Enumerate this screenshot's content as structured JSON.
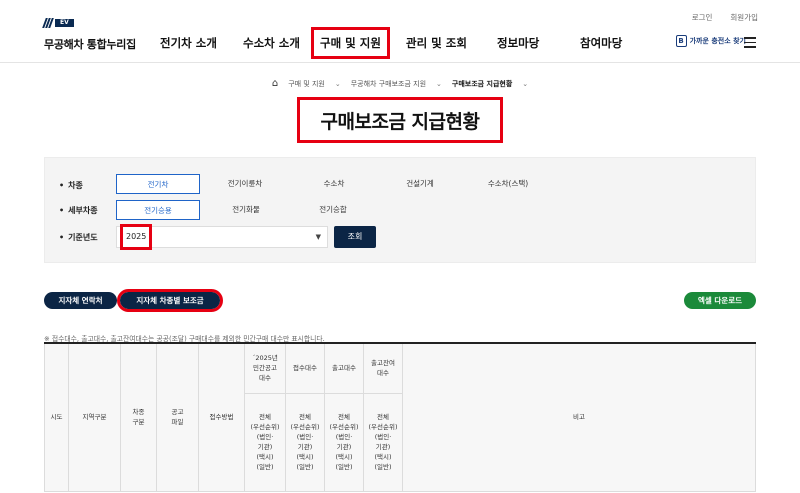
{
  "util": {
    "login": "로그인",
    "join": "회원가입"
  },
  "logo": {
    "badge": "EV",
    "name": "무공해차 통합누리집"
  },
  "nav": [
    "전기차 소개",
    "수소차 소개",
    "구매 및 지원",
    "관리 및 조회",
    "정보마당",
    "참여마당"
  ],
  "nav_selected": "구매 및 지원",
  "find_station": {
    "icon_glyph": "B",
    "label": "가까운 충전소 찾기"
  },
  "breadcrumb": [
    "구매 및 지원",
    "무공해차 구매보조금 지원",
    "구매보조금 지급현황"
  ],
  "page_title": "구매보조금 지급현황",
  "filter": {
    "vehicle_label": "차종",
    "vehicle_options": [
      "전기차",
      "전기이륜차",
      "수소차",
      "건설기계",
      "수소차(스택)"
    ],
    "vehicle_selected": "전기차",
    "detail_label": "세부차종",
    "detail_options": [
      "전기승용",
      "전기화물",
      "전기승합"
    ],
    "detail_selected": "전기승용",
    "year_label": "기준년도",
    "year_value": "2025",
    "search_button": "조회"
  },
  "tabs": [
    "지자체 연락처",
    "지자체 차종별 보조금"
  ],
  "tab_selected": "지자체 차종별 보조금",
  "excel_button": "엑셀 다운로드",
  "note": "※ 접수대수, 출고대수, 출고잔여대수는 공공(조달) 구매대수를 제외한 민간구매 대수만 표시합니다.",
  "table": {
    "headers": {
      "sido": "시도",
      "region": "지역구분",
      "vehicle_type": [
        "차종",
        "구분"
      ],
      "notice": [
        "공고",
        "파일"
      ],
      "method": "접수방법",
      "public_notice": [
        "´2025년",
        "민간공고",
        "대수"
      ],
      "received": "접수대수",
      "shipped": "출고대수",
      "remaining": [
        "출고잔여",
        "대수"
      ],
      "remarks": "비고"
    },
    "sub_header": [
      "전체",
      "(우선순위)",
      "(법인·",
      "기관)",
      "(택시)",
      "(일반)"
    ]
  }
}
